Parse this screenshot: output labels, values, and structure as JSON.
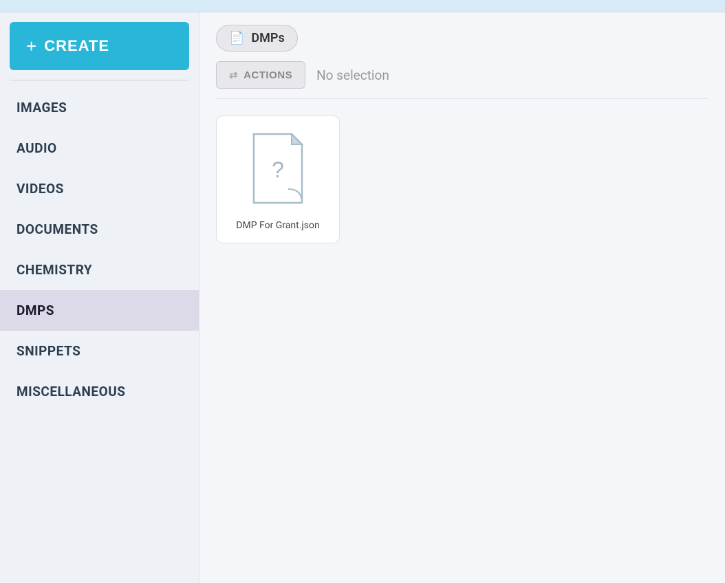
{
  "topbar": {
    "visible": true
  },
  "sidebar": {
    "create_label": "CREATE",
    "plus_symbol": "+",
    "items": [
      {
        "id": "images",
        "label": "IMAGES",
        "active": false
      },
      {
        "id": "audio",
        "label": "AUDIO",
        "active": false
      },
      {
        "id": "videos",
        "label": "VIDEOS",
        "active": false
      },
      {
        "id": "documents",
        "label": "DOCUMENTS",
        "active": false
      },
      {
        "id": "chemistry",
        "label": "CHEMISTRY",
        "active": false
      },
      {
        "id": "dmps",
        "label": "DMPS",
        "active": true
      },
      {
        "id": "snippets",
        "label": "SNIPPETS",
        "active": false
      },
      {
        "id": "miscellaneous",
        "label": "MISCELLANEOUS",
        "active": false
      }
    ]
  },
  "main": {
    "tab_label": "DMPs",
    "actions_label": "ACTIONS",
    "no_selection_text": "No selection",
    "files": [
      {
        "id": "dmp-grant",
        "name": "DMP For Grant.json"
      }
    ]
  },
  "colors": {
    "create_bg": "#29b6d8",
    "active_sidebar_bg": "#dcd9e8",
    "tab_bg": "#e8e8ec"
  }
}
